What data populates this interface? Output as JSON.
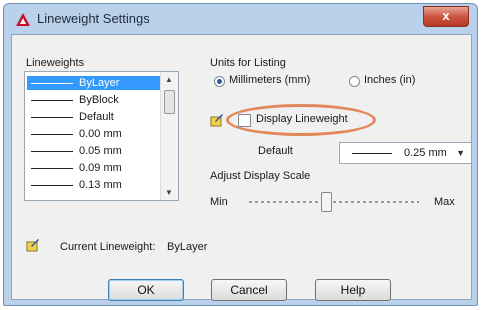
{
  "window": {
    "title": "Lineweight Settings",
    "close_glyph": "x"
  },
  "lineweights": {
    "label": "Lineweights",
    "items": [
      {
        "label": "ByLayer",
        "selected": true
      },
      {
        "label": "ByBlock",
        "selected": false
      },
      {
        "label": "Default",
        "selected": false
      },
      {
        "label": "0.00 mm",
        "selected": false
      },
      {
        "label": "0.05 mm",
        "selected": false
      },
      {
        "label": "0.09 mm",
        "selected": false
      },
      {
        "label": "0.13 mm",
        "selected": false
      }
    ]
  },
  "units": {
    "label": "Units for Listing",
    "options": [
      {
        "label": "Millimeters (mm)",
        "selected": true
      },
      {
        "label": "Inches (in)",
        "selected": false
      }
    ]
  },
  "display_lineweight": {
    "label": "Display Lineweight",
    "checked": false
  },
  "default_setting": {
    "label": "Default",
    "value": "0.25 mm"
  },
  "adjust_scale": {
    "label": "Adjust Display Scale",
    "min_label": "Min",
    "max_label": "Max",
    "level": 0.45
  },
  "current_lineweight": {
    "label": "Current Lineweight:",
    "value": "ByLayer"
  },
  "buttons": {
    "ok": "OK",
    "cancel": "Cancel",
    "help": "Help"
  },
  "colors": {
    "accent": "#e2875a",
    "selection": "#3399ff",
    "titlebar": "#b9d1ea"
  },
  "icons": {
    "app": "autocad-icon",
    "tip": "pencil-note-icon"
  }
}
